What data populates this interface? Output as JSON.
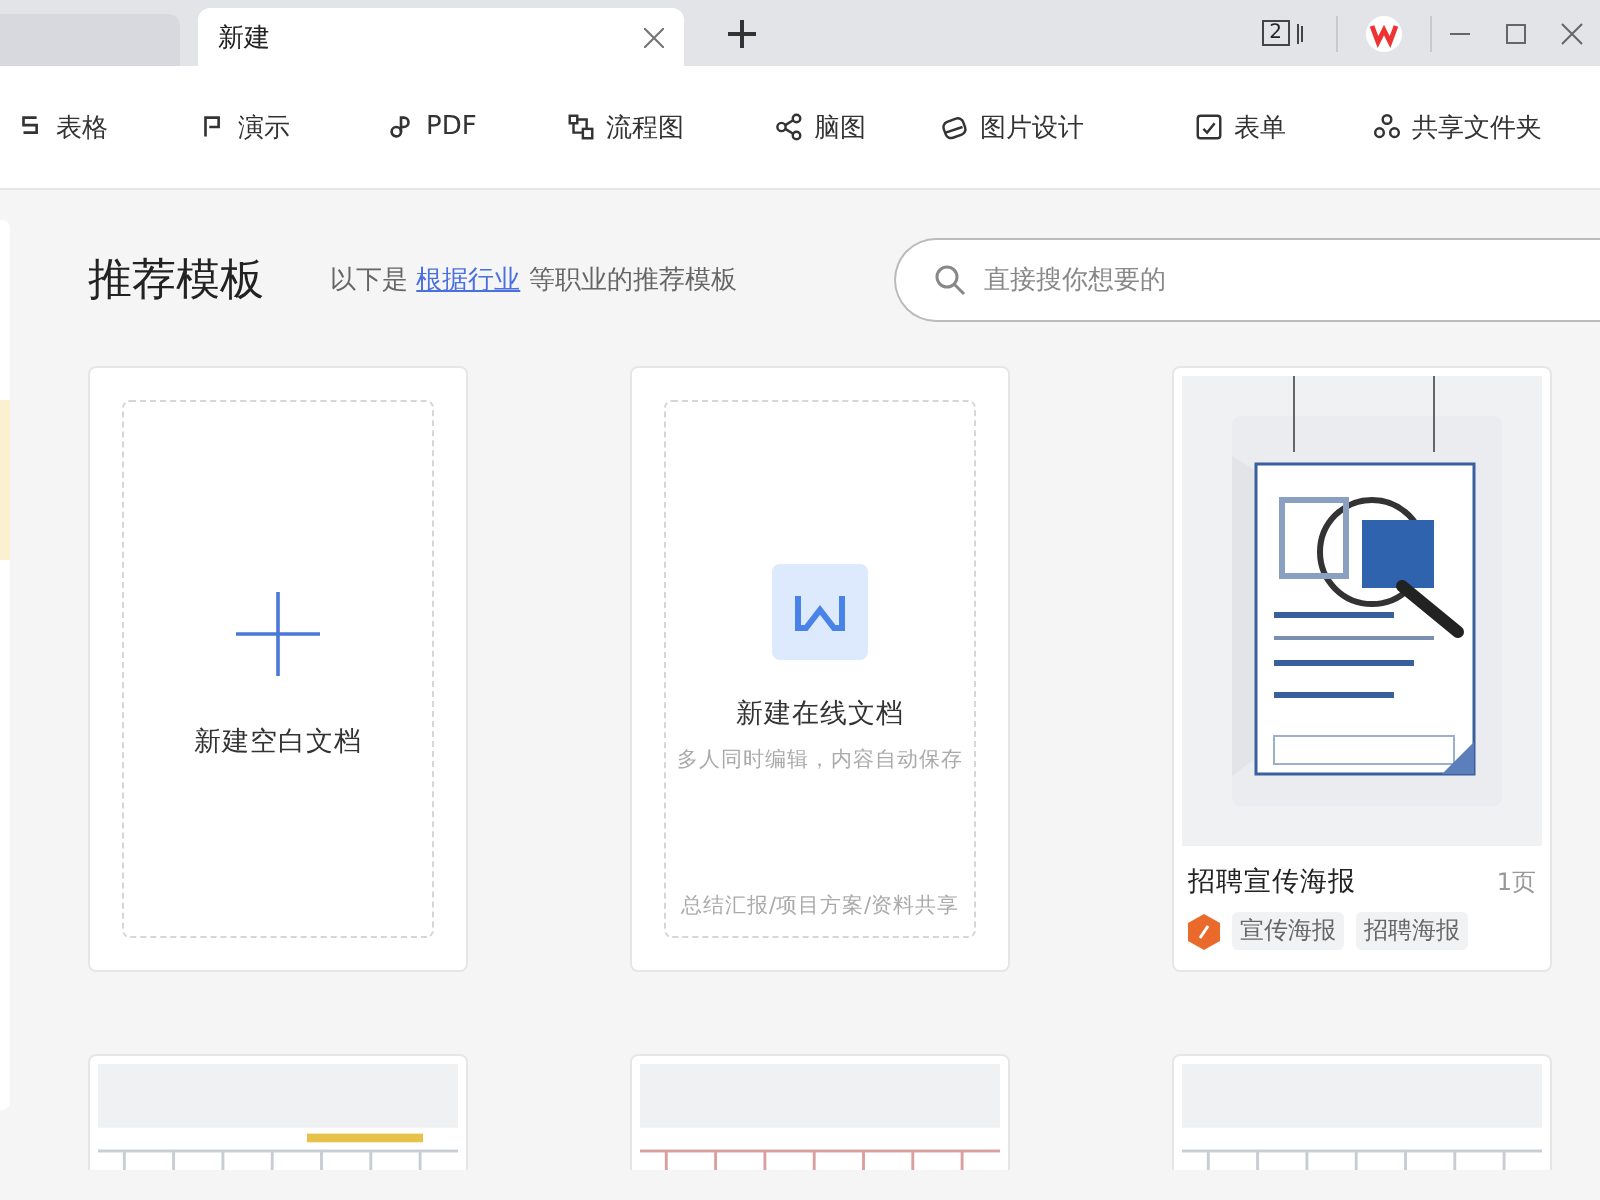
{
  "window": {
    "tabs": [
      {
        "label": "新建",
        "selected": true
      }
    ],
    "window_count": "2"
  },
  "toolbar": {
    "items": [
      {
        "kind": "sheet",
        "label": "表格"
      },
      {
        "kind": "slides",
        "label": "演示"
      },
      {
        "kind": "pdf",
        "label": "PDF"
      },
      {
        "kind": "flow",
        "label": "流程图"
      },
      {
        "kind": "mind",
        "label": "脑图"
      },
      {
        "label": "图片设计"
      },
      {
        "kind": "form",
        "label": "表单"
      },
      {
        "kind": "share",
        "label": "共享文件夹"
      }
    ]
  },
  "header": {
    "title": "推荐模板",
    "subtitle": {
      "before": "以下是",
      "link": "根据行业",
      "after": "等职业的推荐模板"
    },
    "search": {
      "placeholder": "直接搜你想要的"
    }
  },
  "cards": [
    {
      "kind": "blank",
      "title": "新建空白文档"
    },
    {
      "kind": "online",
      "title": "新建在线文档",
      "subtitle": "多人同时编辑，内容自动保存",
      "footer": "总结汇报/项目方案/资料共享"
    },
    {
      "kind": "template",
      "title": "招聘宣传海报",
      "pages": "1页",
      "tags": [
        "宣传海报",
        "招聘海报"
      ]
    },
    {
      "kind": "thumbnail"
    },
    {
      "kind": "thumbnail"
    },
    {
      "kind": "thumbnail"
    }
  ]
}
